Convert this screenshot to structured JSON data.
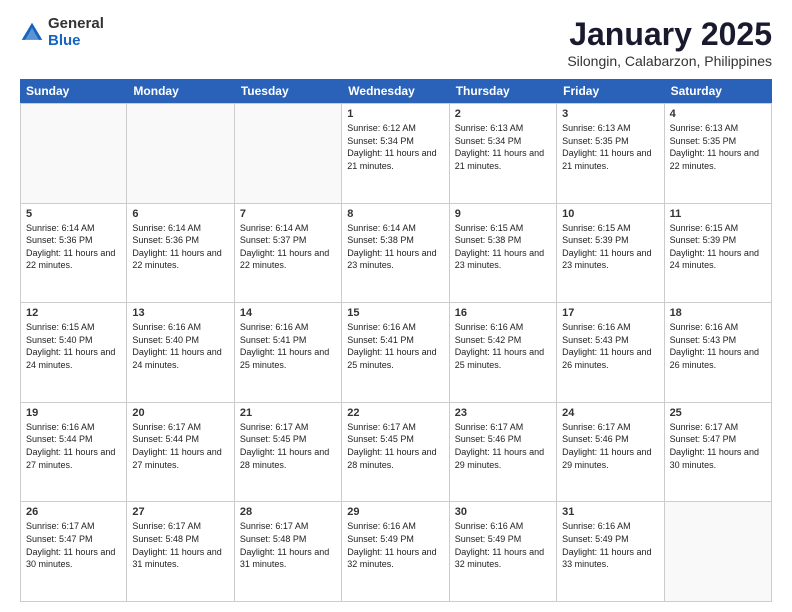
{
  "logo": {
    "general": "General",
    "blue": "Blue"
  },
  "header": {
    "month": "January 2025",
    "location": "Silongin, Calabarzon, Philippines"
  },
  "weekdays": [
    "Sunday",
    "Monday",
    "Tuesday",
    "Wednesday",
    "Thursday",
    "Friday",
    "Saturday"
  ],
  "weeks": [
    [
      {
        "day": "",
        "info": ""
      },
      {
        "day": "",
        "info": ""
      },
      {
        "day": "",
        "info": ""
      },
      {
        "day": "1",
        "info": "Sunrise: 6:12 AM\nSunset: 5:34 PM\nDaylight: 11 hours\nand 21 minutes."
      },
      {
        "day": "2",
        "info": "Sunrise: 6:13 AM\nSunset: 5:34 PM\nDaylight: 11 hours\nand 21 minutes."
      },
      {
        "day": "3",
        "info": "Sunrise: 6:13 AM\nSunset: 5:35 PM\nDaylight: 11 hours\nand 21 minutes."
      },
      {
        "day": "4",
        "info": "Sunrise: 6:13 AM\nSunset: 5:35 PM\nDaylight: 11 hours\nand 22 minutes."
      }
    ],
    [
      {
        "day": "5",
        "info": "Sunrise: 6:14 AM\nSunset: 5:36 PM\nDaylight: 11 hours\nand 22 minutes."
      },
      {
        "day": "6",
        "info": "Sunrise: 6:14 AM\nSunset: 5:36 PM\nDaylight: 11 hours\nand 22 minutes."
      },
      {
        "day": "7",
        "info": "Sunrise: 6:14 AM\nSunset: 5:37 PM\nDaylight: 11 hours\nand 22 minutes."
      },
      {
        "day": "8",
        "info": "Sunrise: 6:14 AM\nSunset: 5:38 PM\nDaylight: 11 hours\nand 23 minutes."
      },
      {
        "day": "9",
        "info": "Sunrise: 6:15 AM\nSunset: 5:38 PM\nDaylight: 11 hours\nand 23 minutes."
      },
      {
        "day": "10",
        "info": "Sunrise: 6:15 AM\nSunset: 5:39 PM\nDaylight: 11 hours\nand 23 minutes."
      },
      {
        "day": "11",
        "info": "Sunrise: 6:15 AM\nSunset: 5:39 PM\nDaylight: 11 hours\nand 24 minutes."
      }
    ],
    [
      {
        "day": "12",
        "info": "Sunrise: 6:15 AM\nSunset: 5:40 PM\nDaylight: 11 hours\nand 24 minutes."
      },
      {
        "day": "13",
        "info": "Sunrise: 6:16 AM\nSunset: 5:40 PM\nDaylight: 11 hours\nand 24 minutes."
      },
      {
        "day": "14",
        "info": "Sunrise: 6:16 AM\nSunset: 5:41 PM\nDaylight: 11 hours\nand 25 minutes."
      },
      {
        "day": "15",
        "info": "Sunrise: 6:16 AM\nSunset: 5:41 PM\nDaylight: 11 hours\nand 25 minutes."
      },
      {
        "day": "16",
        "info": "Sunrise: 6:16 AM\nSunset: 5:42 PM\nDaylight: 11 hours\nand 25 minutes."
      },
      {
        "day": "17",
        "info": "Sunrise: 6:16 AM\nSunset: 5:43 PM\nDaylight: 11 hours\nand 26 minutes."
      },
      {
        "day": "18",
        "info": "Sunrise: 6:16 AM\nSunset: 5:43 PM\nDaylight: 11 hours\nand 26 minutes."
      }
    ],
    [
      {
        "day": "19",
        "info": "Sunrise: 6:16 AM\nSunset: 5:44 PM\nDaylight: 11 hours\nand 27 minutes."
      },
      {
        "day": "20",
        "info": "Sunrise: 6:17 AM\nSunset: 5:44 PM\nDaylight: 11 hours\nand 27 minutes."
      },
      {
        "day": "21",
        "info": "Sunrise: 6:17 AM\nSunset: 5:45 PM\nDaylight: 11 hours\nand 28 minutes."
      },
      {
        "day": "22",
        "info": "Sunrise: 6:17 AM\nSunset: 5:45 PM\nDaylight: 11 hours\nand 28 minutes."
      },
      {
        "day": "23",
        "info": "Sunrise: 6:17 AM\nSunset: 5:46 PM\nDaylight: 11 hours\nand 29 minutes."
      },
      {
        "day": "24",
        "info": "Sunrise: 6:17 AM\nSunset: 5:46 PM\nDaylight: 11 hours\nand 29 minutes."
      },
      {
        "day": "25",
        "info": "Sunrise: 6:17 AM\nSunset: 5:47 PM\nDaylight: 11 hours\nand 30 minutes."
      }
    ],
    [
      {
        "day": "26",
        "info": "Sunrise: 6:17 AM\nSunset: 5:47 PM\nDaylight: 11 hours\nand 30 minutes."
      },
      {
        "day": "27",
        "info": "Sunrise: 6:17 AM\nSunset: 5:48 PM\nDaylight: 11 hours\nand 31 minutes."
      },
      {
        "day": "28",
        "info": "Sunrise: 6:17 AM\nSunset: 5:48 PM\nDaylight: 11 hours\nand 31 minutes."
      },
      {
        "day": "29",
        "info": "Sunrise: 6:16 AM\nSunset: 5:49 PM\nDaylight: 11 hours\nand 32 minutes."
      },
      {
        "day": "30",
        "info": "Sunrise: 6:16 AM\nSunset: 5:49 PM\nDaylight: 11 hours\nand 32 minutes."
      },
      {
        "day": "31",
        "info": "Sunrise: 6:16 AM\nSunset: 5:49 PM\nDaylight: 11 hours\nand 33 minutes."
      },
      {
        "day": "",
        "info": ""
      }
    ]
  ]
}
